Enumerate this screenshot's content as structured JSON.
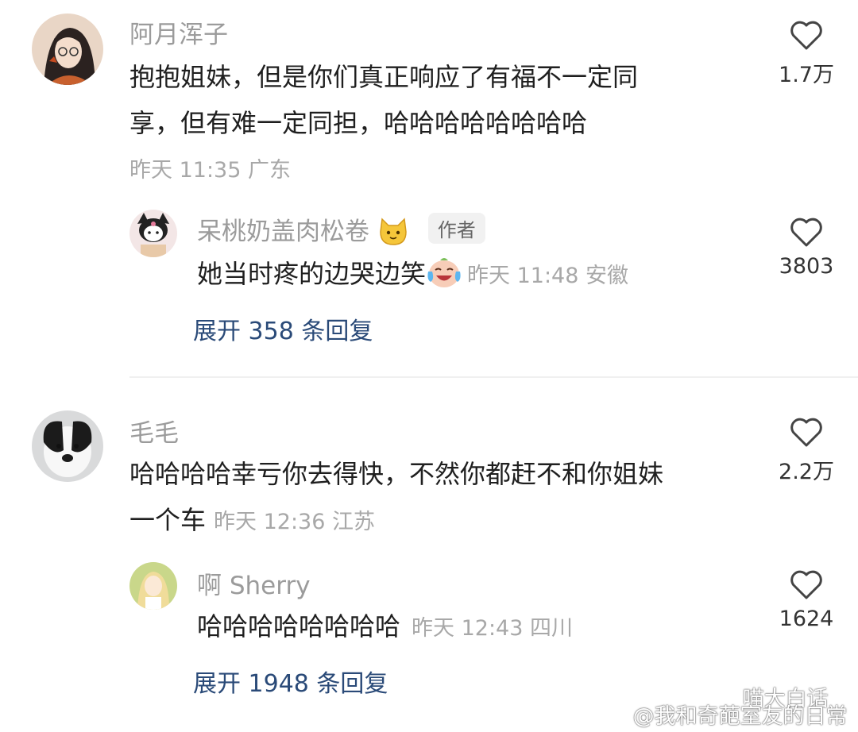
{
  "comments": [
    {
      "username": "阿月浑子",
      "text_line1": "抱抱姐妹，但是你们真正响应了有福不一定同",
      "text_line2": "享，但有难一定同担，哈哈哈哈哈哈哈哈",
      "meta": "昨天 11:35 广东",
      "likes": "1.7万"
    },
    {
      "username": "毛毛",
      "text_line1": "哈哈哈哈幸亏你去得快，不然你都赶不和你姐妹",
      "text_line2": "一个车",
      "meta": "昨天 12:36 江苏",
      "likes": "2.2万"
    }
  ],
  "replies": [
    {
      "username": "呆桃奶盖肉松卷",
      "badge": "作者",
      "text": "她当时疼的边哭边笑",
      "meta": "昨天 11:48 安徽",
      "likes": "3803"
    },
    {
      "username": "啊 Sherry",
      "text": "哈哈哈哈哈哈哈哈",
      "meta": "昨天 12:43 四川",
      "likes": "1624"
    }
  ],
  "expand": [
    "展开 358 条回复",
    "展开 1948 条回复"
  ],
  "watermark": {
    "wechat": "喵大白话",
    "weibo": "@我和奇葩室友的日常"
  },
  "icons": {
    "like": "heart-outline-icon",
    "cat_emoji": "cat-face-emoji",
    "crying_laughing": "tears-of-joy-emoji"
  }
}
